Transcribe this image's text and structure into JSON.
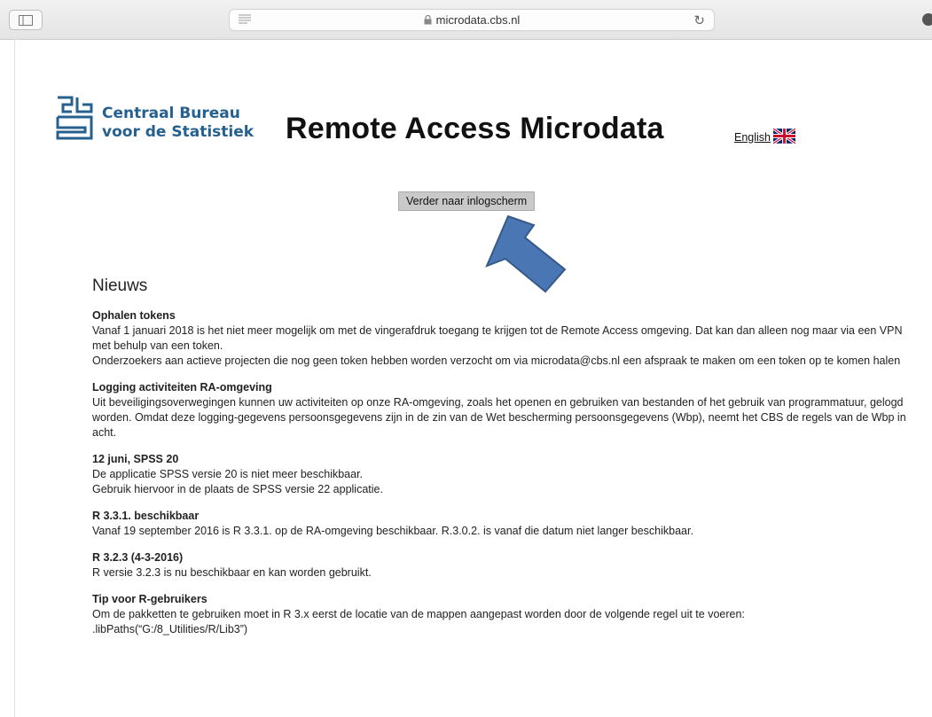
{
  "browser": {
    "url": "microdata.cbs.nl"
  },
  "logo": {
    "line1": "Centraal Bureau",
    "line2": "voor de Statistiek",
    "color": "#25608f"
  },
  "header": {
    "title": "Remote Access Microdata",
    "language_link": "English"
  },
  "login_button": {
    "label": "Verder naar inlogscherm"
  },
  "arrow": {
    "color": "#4a77b4"
  },
  "news": {
    "heading": "Nieuws",
    "items": [
      {
        "title": "Ophalen tokens",
        "lines": [
          "Vanaf 1 januari 2018 is het niet meer mogelijk om met de vingerafdruk toegang te krijgen tot de Remote Access omgeving. Dat kan dan alleen nog maar via een VPN met behulp van een token.",
          "Onderzoekers aan actieve projecten die nog geen token hebben worden verzocht om via microdata@cbs.nl een afspraak te maken om een token op te komen halen"
        ]
      },
      {
        "title": "Logging activiteiten RA-omgeving",
        "lines": [
          "Uit beveiligingsoverwegingen kunnen uw activiteiten op onze RA-omgeving, zoals het openen en gebruiken van bestanden of het gebruik van programmatuur, gelogd worden. Omdat deze logging-gegevens persoonsgegevens zijn in de zin van de Wet bescherming persoonsgegevens (Wbp), neemt het CBS de regels van de Wbp in acht."
        ]
      },
      {
        "title": "12 juni, SPSS 20",
        "lines": [
          "De applicatie SPSS versie 20 is niet meer beschikbaar.",
          "Gebruik hiervoor in de plaats de SPSS versie 22 applicatie."
        ]
      },
      {
        "title": "R 3.3.1. beschikbaar",
        "lines": [
          "Vanaf 19 september 2016 is R 3.3.1. op de RA-omgeving beschikbaar. R.3.0.2. is vanaf die datum niet langer beschikbaar."
        ]
      },
      {
        "title": "R 3.2.3 (4-3-2016)",
        "lines": [
          "R versie 3.2.3 is nu beschikbaar en kan worden gebruikt."
        ]
      },
      {
        "title": "Tip voor R-gebruikers",
        "lines": [
          "Om de pakketten te gebruiken moet in R 3.x eerst de locatie van de mappen aangepast worden door de volgende regel uit te voeren:",
          ".libPaths(“G:/8_Utilities/R/Lib3”)"
        ]
      }
    ]
  }
}
